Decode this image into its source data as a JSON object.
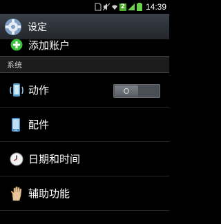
{
  "status_bar": {
    "time": "14:39",
    "badge": "2",
    "icons": [
      "sim-icon",
      "mute-icon",
      "wifi-icon",
      "signal-icon",
      "battery-icon"
    ]
  },
  "action_bar": {
    "title": "设定",
    "icon": "settings-gear-icon"
  },
  "list": {
    "add_account": {
      "label": "添加账户",
      "icon": "add-icon"
    },
    "section_system": "系统",
    "items": [
      {
        "label": "动作",
        "icon": "motion-phone-icon",
        "toggle": {
          "state": "off",
          "knob_label": "O"
        }
      },
      {
        "label": "配件",
        "icon": "accessory-phone-icon"
      },
      {
        "label": "日期和时间",
        "icon": "clock-icon"
      },
      {
        "label": "辅助功能",
        "icon": "hand-icon"
      }
    ]
  },
  "colors": {
    "action_bar_top": "#3a4049",
    "add_icon": "#3fbf3f",
    "toggle_bg": "#4a4f55"
  }
}
